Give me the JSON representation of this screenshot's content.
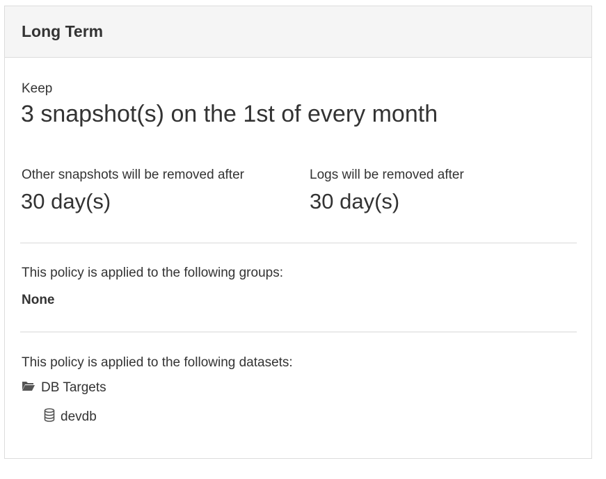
{
  "panel": {
    "title": "Long Term"
  },
  "retention": {
    "keep_label": "Keep",
    "keep_value": "3 snapshot(s) on the 1st of every month",
    "other_label": "Other snapshots will be removed after",
    "other_value": "30 day(s)",
    "logs_label": "Logs will be removed after",
    "logs_value": "30 day(s)"
  },
  "groups": {
    "label": "This policy is applied to the following groups:",
    "value": "None"
  },
  "datasets": {
    "label": "This policy is applied to the following datasets:",
    "folder": {
      "name": "DB Targets",
      "icon": "folder-open-icon"
    },
    "items": [
      {
        "name": "devdb",
        "icon": "database-icon"
      }
    ]
  },
  "colors": {
    "header_bg": "#f5f5f5",
    "border": "#dcdcdc",
    "text": "#333333",
    "icon": "#555555"
  }
}
